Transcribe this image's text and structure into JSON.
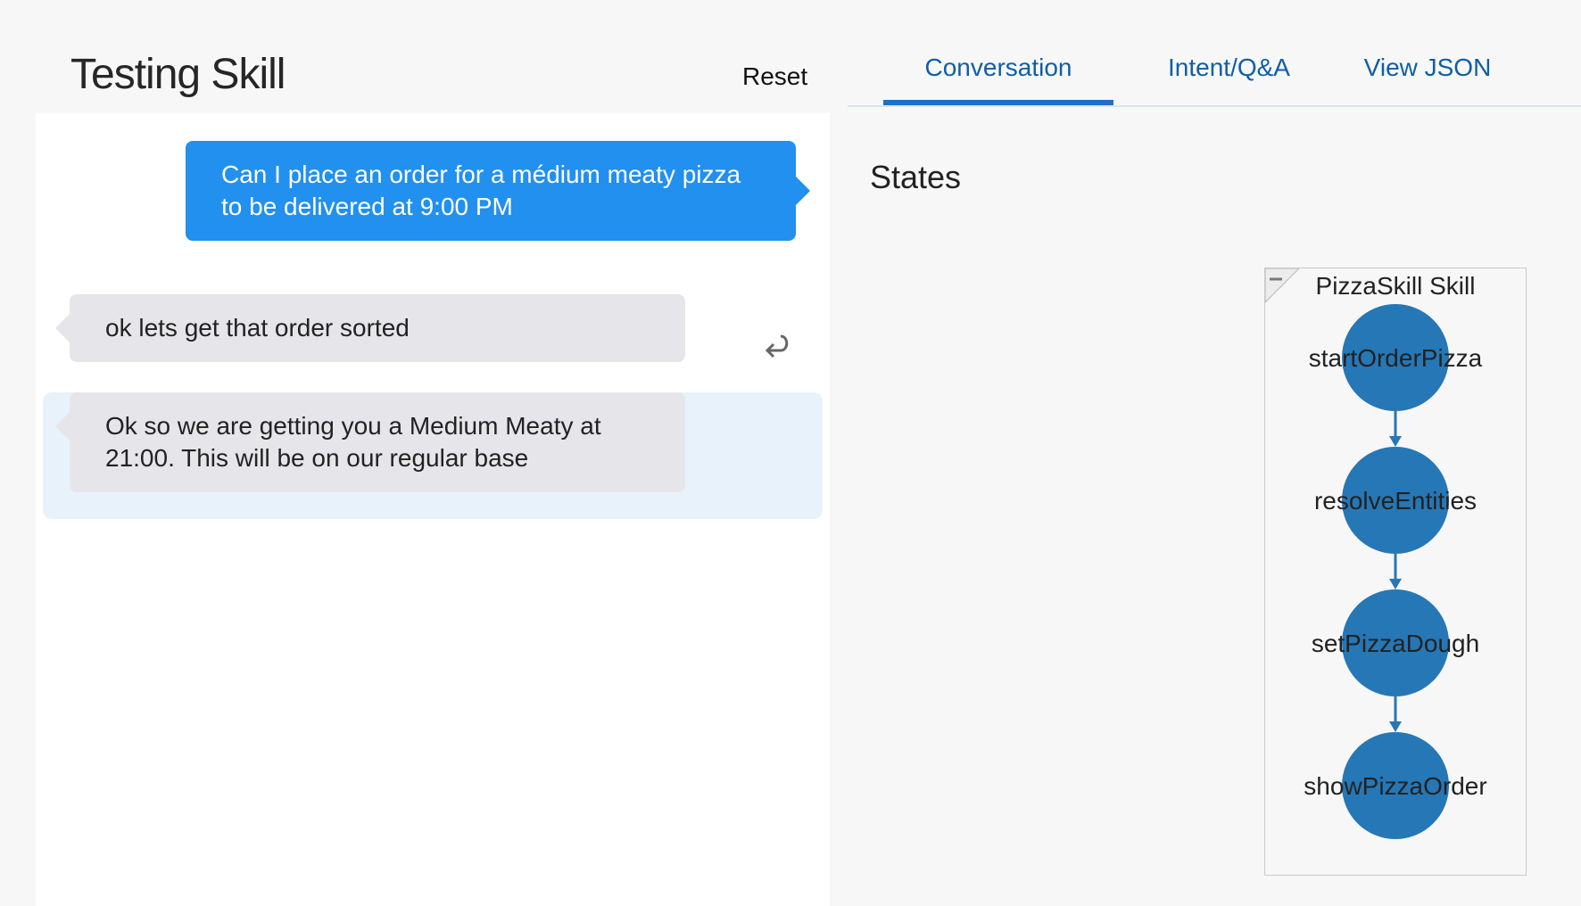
{
  "header": {
    "title": "Testing Skill",
    "reset_label": "Reset"
  },
  "tabs": [
    {
      "label": "Conversation",
      "active": true
    },
    {
      "label": "Intent/Q&A",
      "active": false
    },
    {
      "label": "View JSON",
      "active": false
    }
  ],
  "conversation": {
    "messages": [
      {
        "role": "user",
        "text": "Can I place an order for a médium meaty pizza to be delivered at 9:00 PM"
      },
      {
        "role": "bot",
        "text": "ok lets get that order sorted"
      },
      {
        "role": "bot",
        "text": "Ok so we are getting you a Medium Meaty at 21:00.  This will be on our regular base"
      }
    ],
    "reply_icon": "reply-arrow-icon"
  },
  "states": {
    "title": "States",
    "graph_title": "PizzaSkill Skill",
    "collapse_icon": "minus-icon",
    "nodes": [
      "startOrderPizza",
      "resolveEntities",
      "setPizzaDough",
      "showPizzaOrder"
    ],
    "node_color": "#2677b5",
    "edge_color": "#2677b5"
  },
  "colors": {
    "user_bubble": "#2290ee",
    "bot_bubble": "#e6e6ea",
    "accent": "#1d71c9"
  }
}
